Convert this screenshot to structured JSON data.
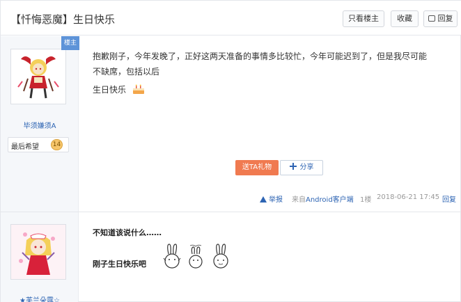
{
  "header": {
    "title": "【忏悔恶魔】生日快乐",
    "btn_only_op": "只看楼主",
    "btn_favorite": "收藏",
    "btn_reply": "回复"
  },
  "post1": {
    "ribbon": "楼主",
    "username": "毕须嫌须A",
    "level_name": "最后希望",
    "level_num": "14",
    "text_line1": "抱歉刚子，今年发晚了，正好这两天准备的事情多比较忙，今年可能迟到了，但是我尽可能",
    "text_line2": "不缺席，包括以后",
    "text_line3": "生日快乐",
    "gift_label": "送TA礼物",
    "share_label": "分享",
    "report": "举报",
    "client_prefix": "来自",
    "client_link": "Android客户端",
    "floor": "1楼",
    "datetime": "2018-06-21 17:45",
    "reply": "回复"
  },
  "post2": {
    "username": "★芙兰朵露☆",
    "text_line1": "不知道该说什么……",
    "text_line2": "刚子生日快乐吧"
  },
  "colors": {
    "link_blue": "#2d64b3",
    "ribbon_blue": "#5d93d8",
    "gift_orange": "#f07a50"
  }
}
